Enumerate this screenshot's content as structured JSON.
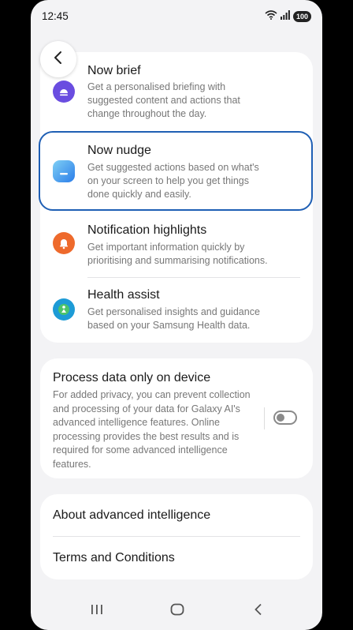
{
  "status": {
    "time": "12:45",
    "battery": "100"
  },
  "icons": {
    "back": "back-arrow-icon",
    "wifi": "wifi-icon",
    "signal": "signal-icon"
  },
  "features": [
    {
      "title": "Now brief",
      "description": "Get a personalised briefing with suggested content and actions that change throughout the day.",
      "icon": "now-brief-icon",
      "color": "#6a4de0"
    },
    {
      "title": "Now nudge",
      "description": "Get suggested actions based on what's on your screen to help you get things done quickly and easily.",
      "icon": "now-nudge-icon",
      "color": "#3aa0e8"
    },
    {
      "title": "Notification highlights",
      "description": "Get important information quickly by prioritising and summarising notifications.",
      "icon": "notification-bell-icon",
      "color": "#ee6a2c"
    },
    {
      "title": "Health assist",
      "description": "Get personalised insights and guidance based on your Samsung Health data.",
      "icon": "health-assist-icon",
      "color": "#1d9bd6"
    }
  ],
  "process_on_device": {
    "title": "Process data only on device",
    "description": "For added privacy, you can prevent collection and processing of your data for Galaxy AI's advanced intelligence features. Online processing provides the best results and is required for some advanced intelligence features.",
    "enabled": false
  },
  "links": {
    "about": "About advanced intelligence",
    "terms": "Terms and Conditions"
  },
  "highlight_color": "#1f5fb4"
}
